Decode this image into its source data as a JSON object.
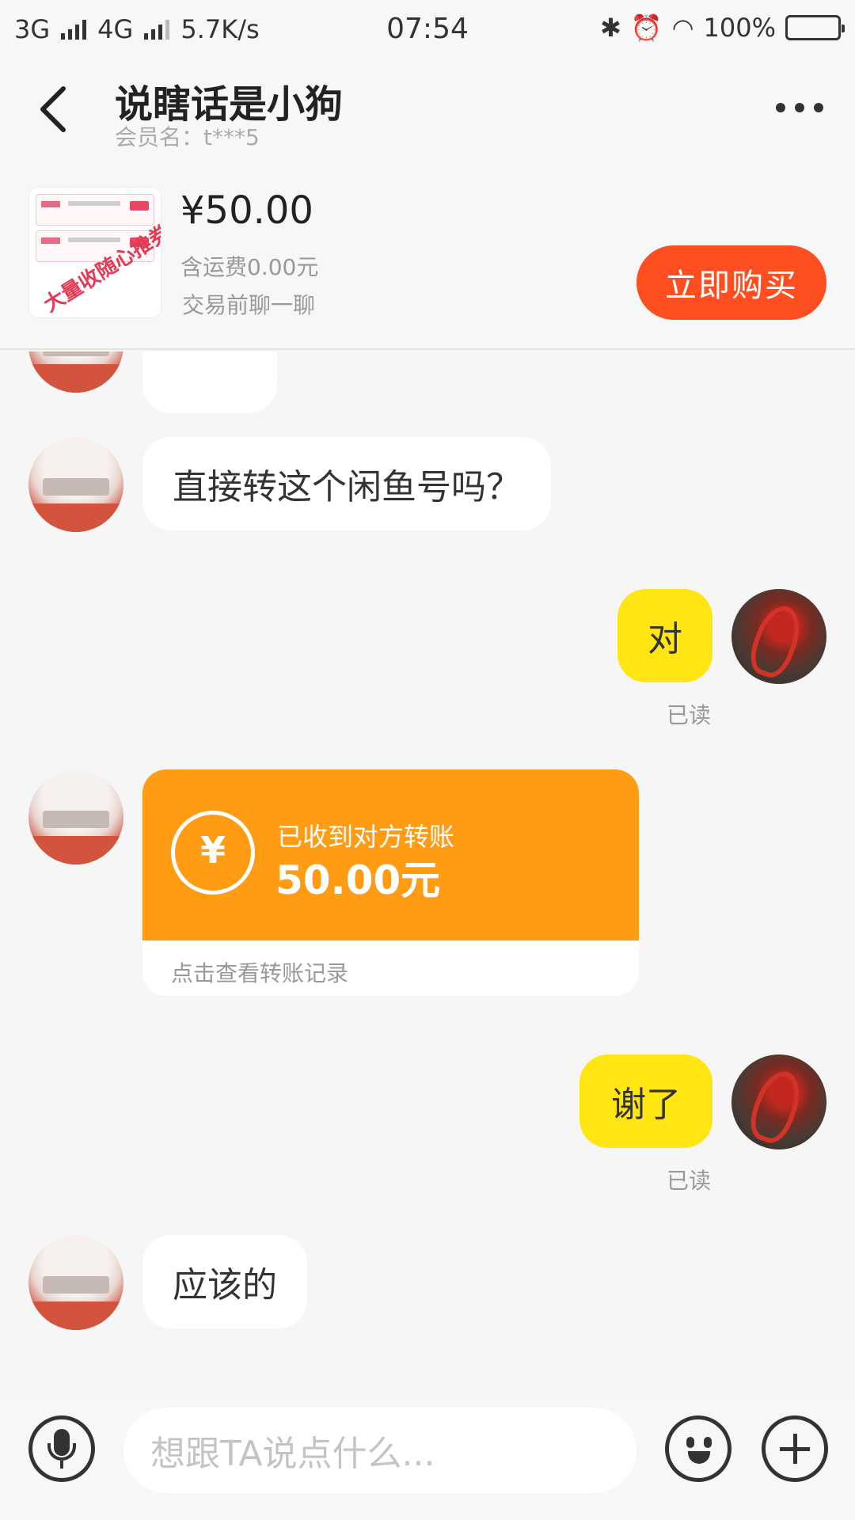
{
  "status_bar": {
    "network1": "3G",
    "network2": "4G",
    "speed": "5.7K/s",
    "time": "07:54",
    "battery": "100%"
  },
  "header": {
    "title": "说瞎话是小狗",
    "member": "会员名：t***5"
  },
  "product": {
    "thumb_stamp": "大量收随心推券",
    "price": "¥50.00",
    "shipping": "含运费0.00元",
    "note": "交易前聊一聊",
    "buy_label": "立即购买"
  },
  "messages": {
    "m1": "直接转这个闲鱼号吗？",
    "m2": "对",
    "m2_status": "已读",
    "transfer_title": "已收到对方转账",
    "transfer_amount": "50.00元",
    "transfer_link": "点击查看转账记录",
    "m3": "谢了",
    "m3_status": "已读",
    "m4": "应该的"
  },
  "input": {
    "placeholder": "想跟TA说点什么..."
  },
  "colors": {
    "accent": "#ff4e20",
    "bubble_self": "#ffe512",
    "transfer": "#ff9c14"
  }
}
